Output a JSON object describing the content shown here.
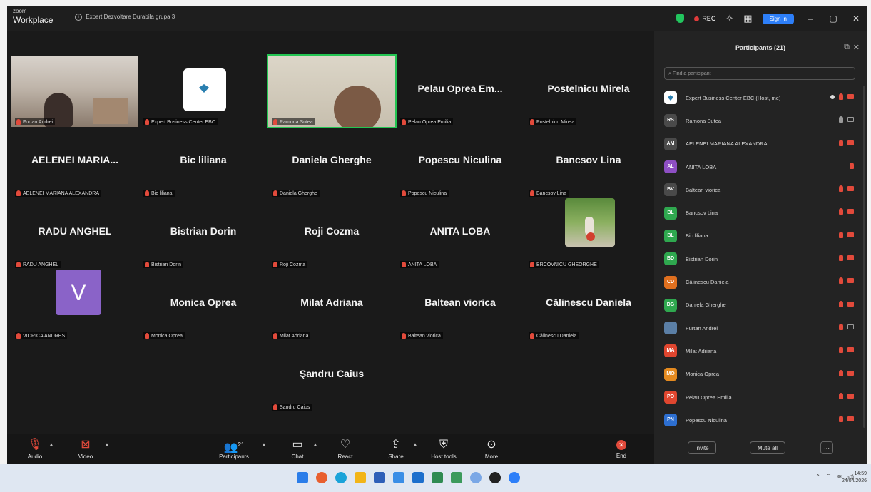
{
  "app": {
    "brand_top": "zoom",
    "brand_bottom": "Workplace",
    "meeting_title": "Expert Dezvoltare Durabila grupa 3"
  },
  "titlebar": {
    "rec_label": "REC",
    "sign_in": "Sign in"
  },
  "tiles": [
    {
      "name": "",
      "label": "Furtan Andrei"
    },
    {
      "name": "",
      "label": "Expert Business Center EBC"
    },
    {
      "name": "",
      "label": "Ramona Sutea"
    },
    {
      "name": "Pelau Oprea Em...",
      "label": "Pelau Oprea Emilia"
    },
    {
      "name": "Postelnicu Mirela",
      "label": "Postelnicu Mirela"
    },
    {
      "name": "AELENEI MARIA...",
      "label": "AELENEI MARIANA ALEXANDRA"
    },
    {
      "name": "Bic liliana",
      "label": "Bic liliana"
    },
    {
      "name": "Daniela Gherghe",
      "label": "Daniela Gherghe"
    },
    {
      "name": "Popescu Niculina",
      "label": "Popescu Niculina"
    },
    {
      "name": "Bancsov Lina",
      "label": "Bancsov Lina"
    },
    {
      "name": "RADU ANGHEL",
      "label": "RADU ANGHEL"
    },
    {
      "name": "Bistrian Dorin",
      "label": "Bistrian Dorin"
    },
    {
      "name": "Roji Cozma",
      "label": "Roji Cozma"
    },
    {
      "name": "ANITA LOBA",
      "label": "ANITA LOBA"
    },
    {
      "name": "",
      "label": "BRCOVNICU GHEORGHE"
    },
    {
      "name": "",
      "label": "VIORICA ANDRES",
      "avatar_letter": "V"
    },
    {
      "name": "Monica Oprea",
      "label": "Monica Oprea"
    },
    {
      "name": "Milat Adriana",
      "label": "Milat Adriana"
    },
    {
      "name": "Baltean viorica",
      "label": "Baltean viorica"
    },
    {
      "name": "Călinescu Daniela",
      "label": "Călinescu Daniela"
    },
    {
      "name": "Şandru Caius",
      "label": "Sandru Caius"
    }
  ],
  "controls": {
    "audio": "Audio",
    "video": "Video",
    "participants": "Participants",
    "participants_count": "21",
    "chat": "Chat",
    "react": "React",
    "share": "Share",
    "host_tools": "Host tools",
    "more": "More",
    "end": "End"
  },
  "panel": {
    "title": "Participants (21)",
    "search_placeholder": "Find a participant",
    "invite": "Invite",
    "mute_all": "Mute all",
    "participants": [
      {
        "initials": "",
        "name": "Expert Business Center EBC (Host, me)",
        "color": "#ffffff",
        "mic": "red",
        "cam": "red",
        "host": true
      },
      {
        "initials": "RS",
        "name": "Ramona Sutea",
        "color": "#4a4a4a",
        "mic": "gray",
        "cam": "gray"
      },
      {
        "initials": "AM",
        "name": "AELENEI MARIANA ALEXANDRA",
        "color": "#4a4a4a",
        "mic": "red",
        "cam": "red"
      },
      {
        "initials": "AL",
        "name": "ANITA LOBA",
        "color": "#8e4fc4",
        "mic": "red",
        "cam": ""
      },
      {
        "initials": "BV",
        "name": "Baltean viorica",
        "color": "#4a4a4a",
        "mic": "red",
        "cam": "red"
      },
      {
        "initials": "BL",
        "name": "Bancsov Lina",
        "color": "#2fa84f",
        "mic": "red",
        "cam": "red"
      },
      {
        "initials": "BL",
        "name": "Bic liliana",
        "color": "#2fa84f",
        "mic": "red",
        "cam": "red"
      },
      {
        "initials": "BD",
        "name": "Bistrian Dorin",
        "color": "#2fa84f",
        "mic": "red",
        "cam": "red"
      },
      {
        "initials": "CD",
        "name": "Călinescu Daniela",
        "color": "#e0701f",
        "mic": "red",
        "cam": "red"
      },
      {
        "initials": "DG",
        "name": "Daniela Gherghe",
        "color": "#2fa84f",
        "mic": "red",
        "cam": "red"
      },
      {
        "initials": "",
        "name": "Furtan Andrei",
        "color": "#5b7fa6",
        "mic": "red",
        "cam": "gray"
      },
      {
        "initials": "MA",
        "name": "Milat Adriana",
        "color": "#e0462f",
        "mic": "red",
        "cam": "red"
      },
      {
        "initials": "MO",
        "name": "Monica Oprea",
        "color": "#e58a1f",
        "mic": "red",
        "cam": "red"
      },
      {
        "initials": "PO",
        "name": "Pelau Oprea Emilia",
        "color": "#e0462f",
        "mic": "red",
        "cam": "red"
      },
      {
        "initials": "PN",
        "name": "Popescu Niculina",
        "color": "#2d6fd1",
        "mic": "red",
        "cam": "red"
      }
    ]
  },
  "clock": {
    "time": "14:59",
    "date": "24/04/2026"
  }
}
